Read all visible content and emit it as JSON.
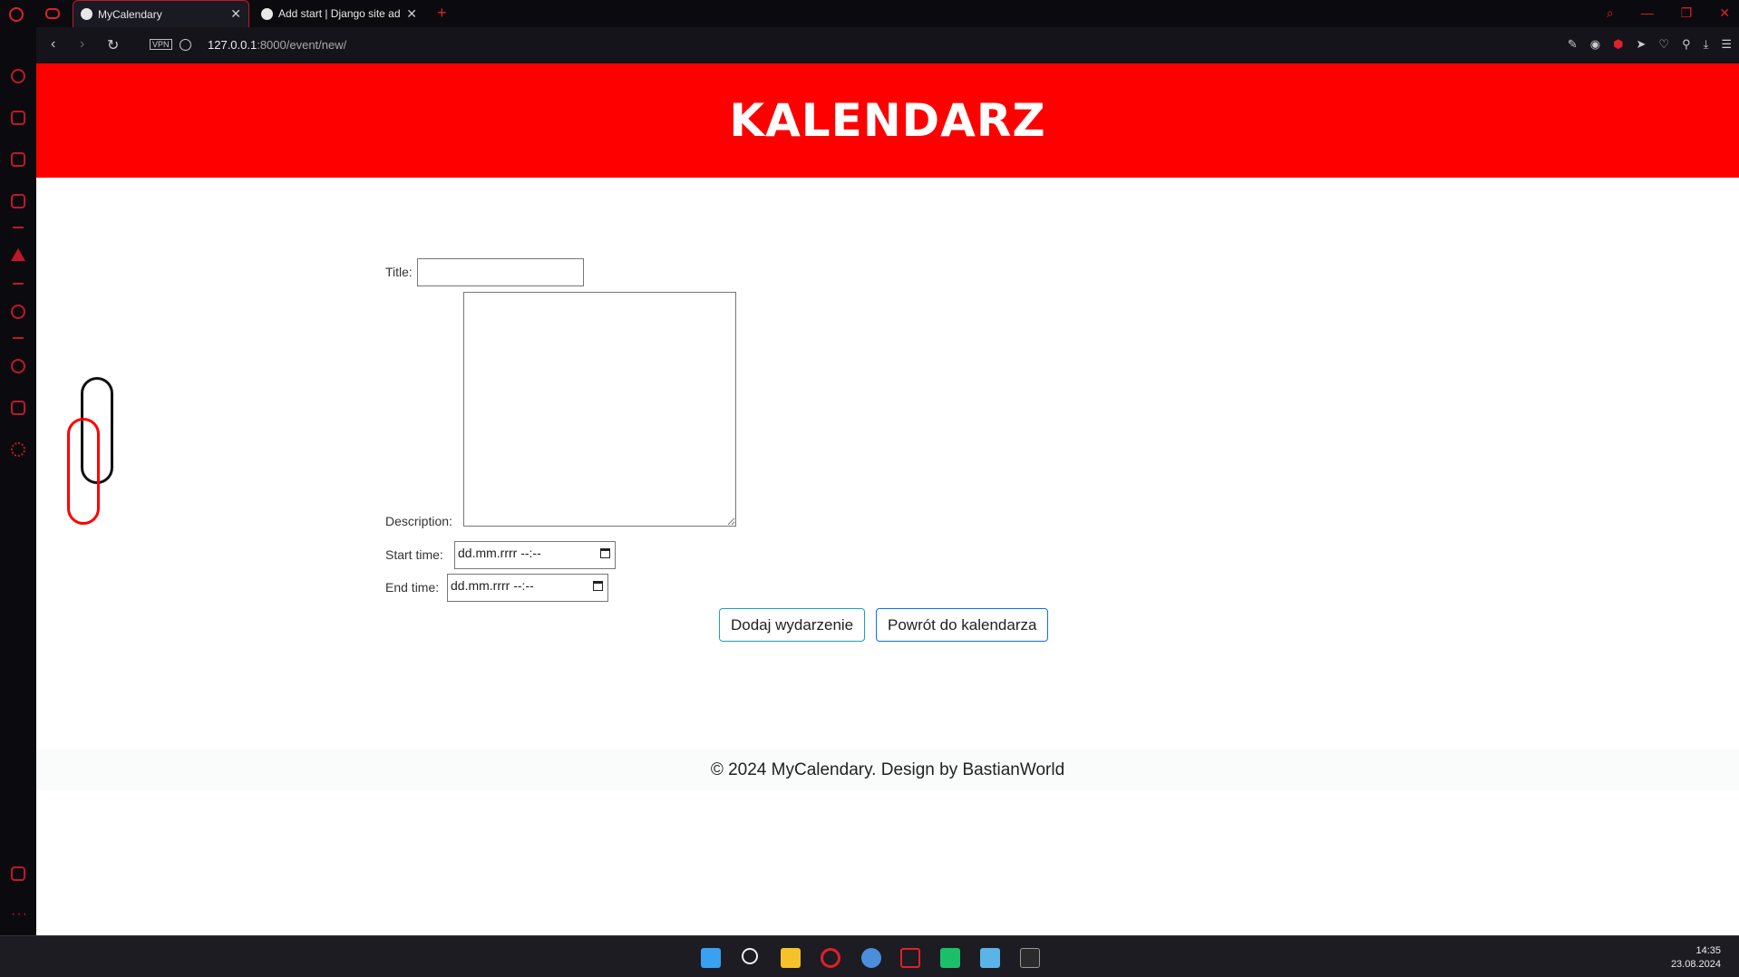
{
  "browser": {
    "tabs": [
      {
        "label": "MyCalendary",
        "close": "✕"
      },
      {
        "label": "Add start | Django site adm",
        "close": "✕"
      }
    ],
    "new_tab": "+",
    "vpn_label": "VPN",
    "url_host": "127.0.0.1",
    "url_rest": ":8000/event/new/",
    "nav_back": "‹",
    "nav_forward": "›",
    "nav_reload": "↻"
  },
  "header": {
    "title": "KALENDARZ",
    "background": "#ff0000"
  },
  "form": {
    "title_label": "Title:",
    "title_value": "",
    "description_label": "Description:",
    "description_value": "",
    "start_label": "Start time:",
    "start_value": "dd.mm.rrrr --:--",
    "end_label": "End time:",
    "end_value": "dd.mm.rrrr --:--"
  },
  "buttons": {
    "add": "Dodaj wydarzenie",
    "back": "Powrót do kalendarza",
    "add_border": "#17a2b8",
    "back_border": "#0d6efd"
  },
  "footer": {
    "text": "© 2024 MyCalendary. Design by BastianWorld"
  },
  "taskbar": {
    "time": "14:35",
    "date": "23.08.2024"
  },
  "icons": {
    "sidebar": [
      "speed-dial-icon",
      "shopping-bag-icon",
      "twitch-icon",
      "calendar-icon",
      "aria-icon",
      "player-icon",
      "history-icon",
      "extensions-icon",
      "settings-icon",
      "gallery-icon"
    ],
    "taskbar": [
      "windows-start-icon",
      "search-icon",
      "file-explorer-icon",
      "opera-icon",
      "app-icon",
      "snipping-tool-icon",
      "pycharm-icon",
      "notepad-icon",
      "terminal-icon"
    ]
  }
}
